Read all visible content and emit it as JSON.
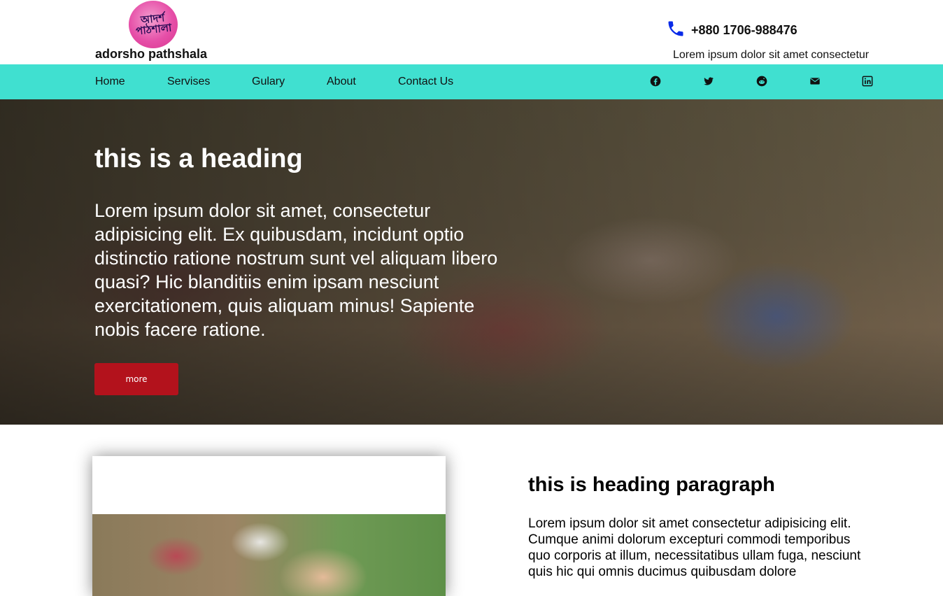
{
  "brand": {
    "logo_text": "আদর্শ পাঠশালা",
    "name": "adorsho pathshala"
  },
  "contact": {
    "phone": "+880 1706-988476",
    "tagline": "Lorem ipsum dolor sit amet consectetur"
  },
  "nav": {
    "items": [
      "Home",
      "Servises",
      "Gulary",
      "About",
      "Contact Us"
    ]
  },
  "social": [
    "facebook-icon",
    "twitter-icon",
    "reddit-icon",
    "envelope-icon",
    "linkedin-icon"
  ],
  "hero": {
    "heading": "this is a heading",
    "paragraph": "Lorem ipsum dolor sit amet, consectetur adipisicing elit. Ex quibusdam, incidunt optio distinctio ratione nostrum sunt vel aliquam libero quasi? Hic blanditiis enim ipsam nesciunt exercitationem, quis aliquam minus! Sapiente nobis facere ratione.",
    "button": "more"
  },
  "section": {
    "heading": "this is heading paragraph",
    "paragraph": "Lorem ipsum dolor sit amet consectetur adipisicing elit. Cumque animi dolorum excepturi commodi temporibus quo corporis at illum, necessitatibus ullam fuga, nesciunt quis hic qui omnis ducimus quibusdam dolore"
  },
  "colors": {
    "nav_bg": "#40e0d0",
    "button_bg": "#b3121c",
    "phone_icon": "#0a2be8"
  }
}
